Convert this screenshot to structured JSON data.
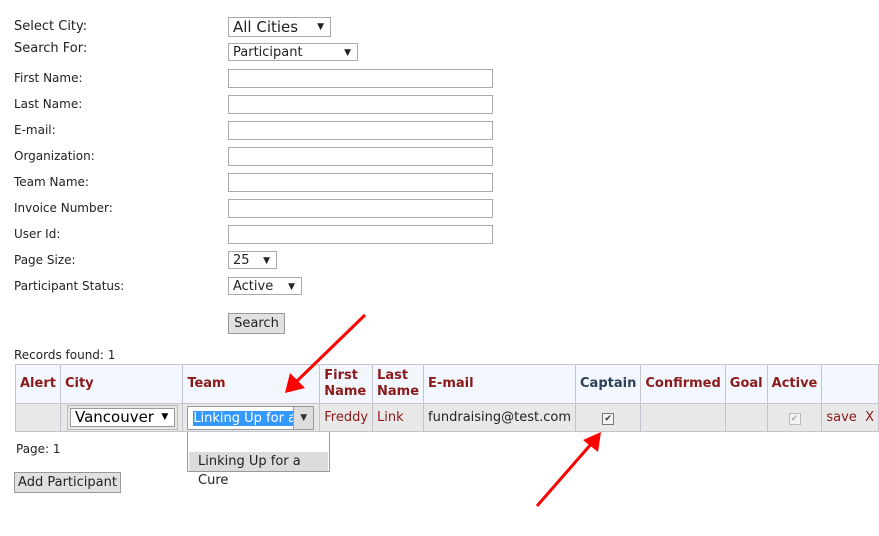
{
  "form": {
    "select_city": {
      "label": "Select City:",
      "value": "All Cities"
    },
    "search_for": {
      "label": "Search For:",
      "value": "Participant"
    },
    "first_name": {
      "label": "First Name:",
      "value": ""
    },
    "last_name": {
      "label": "Last Name:",
      "value": ""
    },
    "email": {
      "label": "E-mail:",
      "value": ""
    },
    "organization": {
      "label": "Organization:",
      "value": ""
    },
    "team_name": {
      "label": "Team Name:",
      "value": ""
    },
    "invoice_number": {
      "label": "Invoice Number:",
      "value": ""
    },
    "user_id": {
      "label": "User Id:",
      "value": ""
    },
    "page_size": {
      "label": "Page Size:",
      "value": "25"
    },
    "participant_status": {
      "label": "Participant Status:",
      "value": "Active"
    },
    "search_button": "Search"
  },
  "records_found": "Records found: 1",
  "table": {
    "headers": [
      "Alert",
      "City",
      "Team",
      "First Name",
      "Last Name",
      "E-mail",
      "Captain",
      "Confirmed",
      "Goal",
      "Active",
      ""
    ],
    "row": {
      "city": "Vancouver",
      "team": "Linking Up for a Cu",
      "first": "Freddy",
      "last": "Link",
      "email": "fundraising@test.com",
      "captain": true,
      "active": true,
      "save": "save",
      "delete": "X"
    }
  },
  "team_dropdown_options": [
    "",
    "Linking Up for a Cure"
  ],
  "page": "Page: 1",
  "add_participant": "Add Participant",
  "colors": {
    "header_text": "#8b1a1a",
    "captain_header": "#2d4059",
    "arrow": "#ff0000",
    "selection": "#3399ff"
  }
}
